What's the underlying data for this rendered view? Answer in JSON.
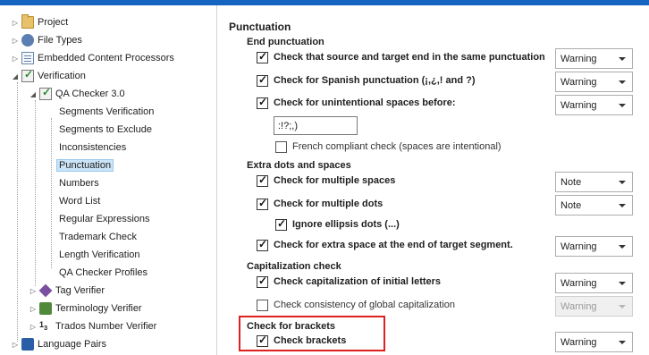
{
  "tree": {
    "items": [
      {
        "label": "Project",
        "icon": "folder-icon",
        "expander": "▷"
      },
      {
        "label": "File Types",
        "icon": "file-types-icon",
        "expander": "▷"
      },
      {
        "label": "Embedded Content Processors",
        "icon": "document-icon",
        "expander": "▷"
      },
      {
        "label": "Verification",
        "icon": "verification-icon",
        "expander": "◢"
      },
      {
        "label": "QA Checker 3.0",
        "icon": "qa-checker-icon",
        "expander": "◢"
      },
      {
        "label": "Segments Verification"
      },
      {
        "label": "Segments to Exclude"
      },
      {
        "label": "Inconsistencies"
      },
      {
        "label": "Punctuation"
      },
      {
        "label": "Numbers"
      },
      {
        "label": "Word List"
      },
      {
        "label": "Regular Expressions"
      },
      {
        "label": "Trademark Check"
      },
      {
        "label": "Length Verification"
      },
      {
        "label": "QA Checker Profiles"
      },
      {
        "label": "Tag Verifier",
        "icon": "tag-verifier-icon",
        "expander": "▷"
      },
      {
        "label": "Terminology Verifier",
        "icon": "terminology-verifier-icon",
        "expander": "▷"
      },
      {
        "label": "Trados Number Verifier",
        "icon": "number-verifier-icon",
        "expander": "▷"
      },
      {
        "label": "Language Pairs",
        "icon": "language-pairs-icon",
        "expander": "▷"
      }
    ]
  },
  "panel": {
    "title": "Punctuation",
    "end_punctuation": {
      "heading": "End punctuation",
      "same_punct": {
        "label": "Check that source and target end in the same punctuation",
        "severity": "Warning"
      },
      "spanish": {
        "label": "Check for Spanish punctuation (¡,¿,! and ?)",
        "severity": "Warning"
      },
      "spaces_before": {
        "label": "Check for unintentional spaces before:",
        "severity": "Warning"
      },
      "chars_value": ":!?;,)",
      "french": {
        "label": "French compliant check (spaces are intentional)"
      }
    },
    "extra_dots": {
      "heading": "Extra dots and spaces",
      "multiple_spaces": {
        "label": "Check for multiple spaces",
        "severity": "Note"
      },
      "multiple_dots": {
        "label": "Check for multiple dots",
        "severity": "Note"
      },
      "ellipsis": {
        "label": "Ignore ellipsis dots (...)"
      },
      "extra_space_end": {
        "label": "Check for extra space at the end of target segment.",
        "severity": "Warning"
      }
    },
    "capitalization": {
      "heading": "Capitalization check",
      "initial": {
        "label": "Check capitalization of initial letters",
        "severity": "Warning"
      },
      "global": {
        "label": "Check consistency of global capitalization",
        "severity": "Warning"
      }
    },
    "brackets": {
      "heading": "Check for brackets",
      "check": {
        "label": "Check brackets",
        "severity": "Warning"
      }
    }
  },
  "colors": {
    "accent_bar": "#1565c0",
    "highlight_box": "#e02020",
    "selection": "#cce4f7"
  }
}
